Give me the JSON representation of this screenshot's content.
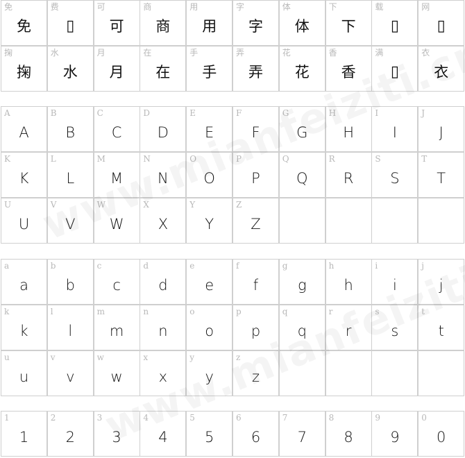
{
  "watermark": "www.mianfeiziti.cn",
  "sections": [
    {
      "id": "chinese",
      "rows": [
        [
          {
            "ref": "免",
            "glyph": "免"
          },
          {
            "ref": "费",
            "glyph": "▯"
          },
          {
            "ref": "可",
            "glyph": "可"
          },
          {
            "ref": "商",
            "glyph": "商"
          },
          {
            "ref": "用",
            "glyph": "用"
          },
          {
            "ref": "字",
            "glyph": "字"
          },
          {
            "ref": "体",
            "glyph": "体"
          },
          {
            "ref": "下",
            "glyph": "下"
          },
          {
            "ref": "载",
            "glyph": "▯"
          },
          {
            "ref": "网",
            "glyph": "▯"
          }
        ],
        [
          {
            "ref": "掬",
            "glyph": "掬"
          },
          {
            "ref": "水",
            "glyph": "水"
          },
          {
            "ref": "月",
            "glyph": "月"
          },
          {
            "ref": "在",
            "glyph": "在"
          },
          {
            "ref": "手",
            "glyph": "手"
          },
          {
            "ref": "弄",
            "glyph": "弄"
          },
          {
            "ref": "花",
            "glyph": "花"
          },
          {
            "ref": "香",
            "glyph": "香"
          },
          {
            "ref": "满",
            "glyph": "▯"
          },
          {
            "ref": "衣",
            "glyph": "衣"
          }
        ]
      ]
    },
    {
      "id": "uppercase",
      "rows": [
        [
          {
            "ref": "A",
            "glyph": "A"
          },
          {
            "ref": "B",
            "glyph": "B"
          },
          {
            "ref": "C",
            "glyph": "C"
          },
          {
            "ref": "D",
            "glyph": "D"
          },
          {
            "ref": "E",
            "glyph": "E"
          },
          {
            "ref": "F",
            "glyph": "F"
          },
          {
            "ref": "G",
            "glyph": "G"
          },
          {
            "ref": "H",
            "glyph": "H"
          },
          {
            "ref": "I",
            "glyph": "I"
          },
          {
            "ref": "J",
            "glyph": "J"
          }
        ],
        [
          {
            "ref": "K",
            "glyph": "K"
          },
          {
            "ref": "L",
            "glyph": "L"
          },
          {
            "ref": "M",
            "glyph": "M"
          },
          {
            "ref": "N",
            "glyph": "N"
          },
          {
            "ref": "O",
            "glyph": "O"
          },
          {
            "ref": "P",
            "glyph": "P"
          },
          {
            "ref": "Q",
            "glyph": "Q"
          },
          {
            "ref": "R",
            "glyph": "R"
          },
          {
            "ref": "S",
            "glyph": "S"
          },
          {
            "ref": "T",
            "glyph": "T"
          }
        ],
        [
          {
            "ref": "U",
            "glyph": "U"
          },
          {
            "ref": "V",
            "glyph": "V"
          },
          {
            "ref": "W",
            "glyph": "W"
          },
          {
            "ref": "X",
            "glyph": "X"
          },
          {
            "ref": "Y",
            "glyph": "Y"
          },
          {
            "ref": "Z",
            "glyph": "Z"
          },
          {
            "ref": "",
            "glyph": ""
          },
          {
            "ref": "",
            "glyph": ""
          },
          {
            "ref": "",
            "glyph": ""
          },
          {
            "ref": "",
            "glyph": ""
          }
        ]
      ]
    },
    {
      "id": "lowercase",
      "rows": [
        [
          {
            "ref": "a",
            "glyph": "a"
          },
          {
            "ref": "b",
            "glyph": "b"
          },
          {
            "ref": "c",
            "glyph": "c"
          },
          {
            "ref": "d",
            "glyph": "d"
          },
          {
            "ref": "e",
            "glyph": "e"
          },
          {
            "ref": "f",
            "glyph": "f"
          },
          {
            "ref": "g",
            "glyph": "g"
          },
          {
            "ref": "h",
            "glyph": "h"
          },
          {
            "ref": "i",
            "glyph": "i"
          },
          {
            "ref": "j",
            "glyph": "j"
          }
        ],
        [
          {
            "ref": "k",
            "glyph": "k"
          },
          {
            "ref": "l",
            "glyph": "l"
          },
          {
            "ref": "m",
            "glyph": "m"
          },
          {
            "ref": "n",
            "glyph": "n"
          },
          {
            "ref": "o",
            "glyph": "o"
          },
          {
            "ref": "p",
            "glyph": "p"
          },
          {
            "ref": "q",
            "glyph": "q"
          },
          {
            "ref": "r",
            "glyph": "r"
          },
          {
            "ref": "s",
            "glyph": "s"
          },
          {
            "ref": "t",
            "glyph": "t"
          }
        ],
        [
          {
            "ref": "u",
            "glyph": "u"
          },
          {
            "ref": "v",
            "glyph": "v"
          },
          {
            "ref": "w",
            "glyph": "w"
          },
          {
            "ref": "x",
            "glyph": "x"
          },
          {
            "ref": "y",
            "glyph": "y"
          },
          {
            "ref": "z",
            "glyph": "z"
          },
          {
            "ref": "",
            "glyph": ""
          },
          {
            "ref": "",
            "glyph": ""
          },
          {
            "ref": "",
            "glyph": ""
          },
          {
            "ref": "",
            "glyph": ""
          }
        ]
      ]
    },
    {
      "id": "digits",
      "rows": [
        [
          {
            "ref": "1",
            "glyph": "1"
          },
          {
            "ref": "2",
            "glyph": "2"
          },
          {
            "ref": "3",
            "glyph": "3"
          },
          {
            "ref": "4",
            "glyph": "4"
          },
          {
            "ref": "5",
            "glyph": "5"
          },
          {
            "ref": "6",
            "glyph": "6"
          },
          {
            "ref": "7",
            "glyph": "7"
          },
          {
            "ref": "8",
            "glyph": "8"
          },
          {
            "ref": "9",
            "glyph": "9"
          },
          {
            "ref": "0",
            "glyph": "0"
          }
        ]
      ]
    }
  ]
}
